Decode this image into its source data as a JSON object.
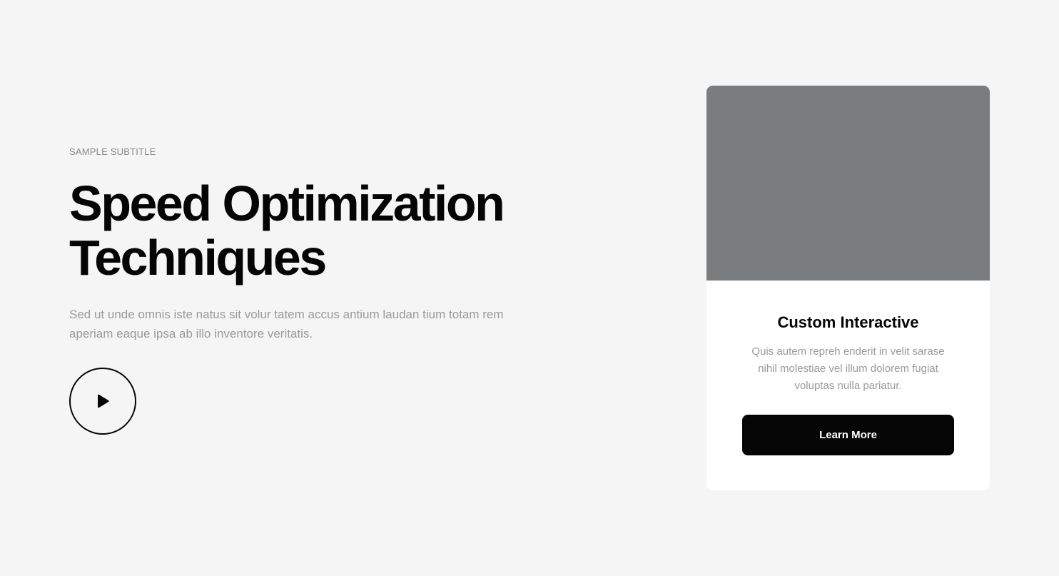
{
  "hero": {
    "subtitle": "SAMPLE SUBTITLE",
    "title_line1": "Speed Optimization",
    "title_line2": "Techniques",
    "description": "Sed ut unde omnis iste natus sit volur tatem accus antium laudan tium totam rem aperiam eaque ipsa ab illo inventore veritatis.",
    "play_icon": "play-icon"
  },
  "card": {
    "title": "Custom Interactive",
    "text": "Quis autem repreh enderit in velit sarase nihil molestiae vel illum dolorem fugiat voluptas nulla pariatur.",
    "button_label": "Learn More"
  },
  "colors": {
    "background": "#f5f5f5",
    "text_dark": "#050505",
    "text_muted": "#9a9a9a",
    "image_placeholder": "#7b7c7d",
    "button_bg": "#050505",
    "button_text": "#ffffff"
  }
}
